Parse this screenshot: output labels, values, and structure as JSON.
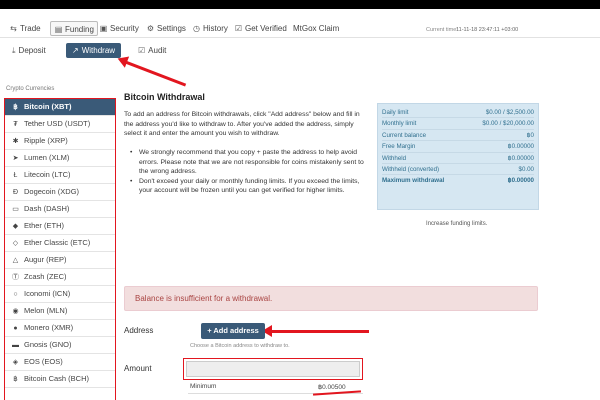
{
  "nav": {
    "items": [
      {
        "label": "Trade",
        "icon": "exchange-icon"
      },
      {
        "label": "Funding",
        "icon": "wallet-icon",
        "active": true
      },
      {
        "label": "Security",
        "icon": "lock-icon"
      },
      {
        "label": "Settings",
        "icon": "wrench-icon"
      },
      {
        "label": "History",
        "icon": "clock-icon"
      },
      {
        "label": "Get Verified",
        "icon": "check-square-icon"
      },
      {
        "label": "MtGox Claim"
      }
    ],
    "time_label": "Current time:",
    "time_value": "11-11-18 23:47:11 +03:00"
  },
  "subnav": {
    "deposit": "Deposit",
    "withdraw": "Withdraw",
    "audit": "Audit"
  },
  "crypto": {
    "title": "Crypto Currencies",
    "items": [
      {
        "label": "Bitcoin (XBT)",
        "icon": "bitcoin-icon",
        "active": true
      },
      {
        "label": "Tether USD (USDT)",
        "icon": "tether-icon"
      },
      {
        "label": "Ripple (XRP)",
        "icon": "ripple-icon"
      },
      {
        "label": "Lumen (XLM)",
        "icon": "rocket-icon"
      },
      {
        "label": "Litecoin (LTC)",
        "icon": "litecoin-icon"
      },
      {
        "label": "Dogecoin (XDG)",
        "icon": "dogecoin-icon"
      },
      {
        "label": "Dash (DASH)",
        "icon": "dash-icon"
      },
      {
        "label": "Ether (ETH)",
        "icon": "ether-icon"
      },
      {
        "label": "Ether Classic (ETC)",
        "icon": "ether-classic-icon"
      },
      {
        "label": "Augur (REP)",
        "icon": "augur-icon"
      },
      {
        "label": "Zcash (ZEC)",
        "icon": "zcash-icon"
      },
      {
        "label": "Iconomi (ICN)",
        "icon": "iconomi-icon"
      },
      {
        "label": "Melon (MLN)",
        "icon": "melon-icon"
      },
      {
        "label": "Monero (XMR)",
        "icon": "monero-icon"
      },
      {
        "label": "Gnosis (GNO)",
        "icon": "gnosis-icon"
      },
      {
        "label": "EOS (EOS)",
        "icon": "eos-icon"
      },
      {
        "label": "Bitcoin Cash (BCH)",
        "icon": "bitcoin-cash-icon"
      }
    ]
  },
  "main": {
    "heading": "Bitcoin Withdrawal",
    "intro": "To add an address for Bitcoin withdrawals, click \"Add address\" below and fill in the address you'd like to withdraw to. After you've added the address, simply select it and enter the amount you wish to withdraw.",
    "bullets": [
      "We strongly recommend that you copy + paste the address to help avoid errors. Please note that we are not responsible for coins mistakenly sent to the wrong address.",
      "Don't exceed your daily or monthly funding limits. If you exceed the limits, your account will be frozen until you can get verified for higher limits."
    ],
    "alert": "Balance is insufficient for a withdrawal.",
    "address_label": "Address",
    "add_button": "Add address",
    "choose_hint": "Choose a Bitcoin address to withdraw to.",
    "amount_label": "Amount",
    "amount_value": "",
    "minimum_label": "Minimum",
    "minimum_value": "฿0.00500"
  },
  "limits": {
    "rows": [
      {
        "label": "Daily limit",
        "value": "$0.00 / $2,500.00"
      },
      {
        "label": "Monthly limit",
        "value": "$0.00 / $20,000.00"
      },
      {
        "label": "Current balance",
        "value": "฿0"
      },
      {
        "label": "Free Margin",
        "value": "฿0.00000"
      },
      {
        "label": "Withheld",
        "value": "฿0.00000"
      },
      {
        "label": "Withheld (converted)",
        "value": "$0.00"
      },
      {
        "label": "Maximum withdrawal",
        "value": "฿0.00000",
        "bold": true
      }
    ],
    "increase_link": "Increase funding limits."
  },
  "colors": {
    "accent": "#3a5a78",
    "annotation": "#e2161f",
    "limits_bg": "#d6e7f2",
    "alert_bg": "#f2dede",
    "alert_text": "#a94442"
  }
}
